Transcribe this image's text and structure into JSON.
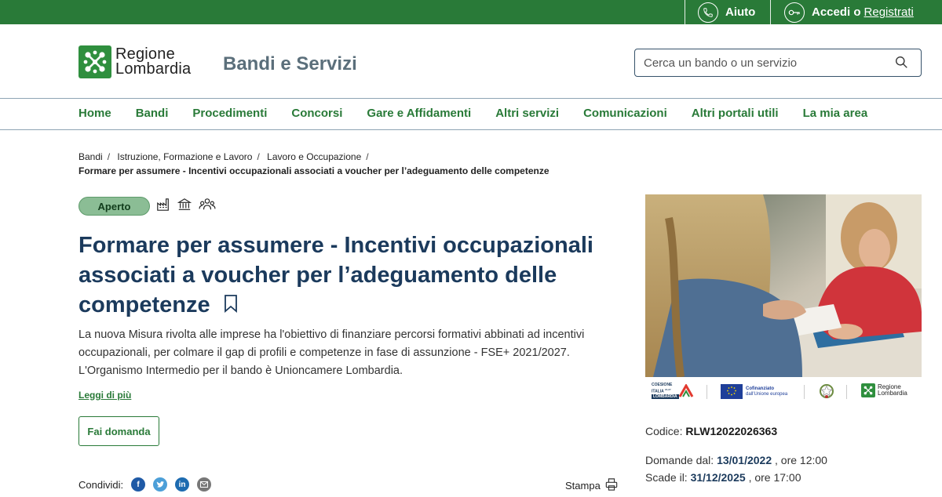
{
  "topbar": {
    "help_label": "Aiuto",
    "login_label": "Accedi o",
    "register_label": "Registrati"
  },
  "header": {
    "logo_line1": "Regione",
    "logo_line2": "Lombardia",
    "site_title": "Bandi e Servizi",
    "search_placeholder": "Cerca un bando o un servizio"
  },
  "nav": {
    "items": [
      "Home",
      "Bandi",
      "Procedimenti",
      "Concorsi",
      "Gare e Affidamenti",
      "Altri servizi",
      "Comunicazioni",
      "Altri portali utili",
      "La mia area"
    ]
  },
  "breadcrumb": {
    "items": [
      "Bandi",
      "Istruzione, Formazione e Lavoro",
      "Lavoro e Occupazione"
    ],
    "current": "Formare per assumere - Incentivi occupazionali associati a voucher per l’adeguamento delle competenze"
  },
  "status": {
    "label": "Aperto",
    "color": "#8bbd95"
  },
  "category_icons": [
    "factory-icon",
    "bank-icon",
    "people-icon"
  ],
  "main": {
    "title": "Formare per assumere - Incentivi occupazionali associati a voucher per l’adeguamento delle competenze",
    "description": "La nuova Misura rivolta alle imprese ha l'obiettivo di finanziare percorsi formativi abbinati ad incentivi occupazionali, per colmare il gap di profili e competenze in fase di assunzione - FSE+ 2021/2027. L'Organismo Intermedio per il bando è Unioncamere Lombardia.",
    "read_more": "Leggi di più",
    "apply_label": "Fai domanda",
    "share_label": "Condividi:",
    "print_label": "Stampa"
  },
  "sidebar": {
    "logos": {
      "coesione_l1": "COESIONE",
      "coesione_l2": "ITALIA",
      "coesione_sup": "21-27",
      "coesione_l3": "LOMBARDIA",
      "eu_l1": "Cofinanziato",
      "eu_l2": "dall'Unione europea",
      "rl_l1": "Regione",
      "rl_l2": "Lombardia"
    },
    "code_label": "Codice:",
    "code_value": "RLW12022026363",
    "open_label": "Domande dal:",
    "open_date": "13/01/2022",
    "open_time": ", ore 12:00",
    "close_label": "Scade il:",
    "close_date": "31/12/2025",
    "close_time": ", ore 17:00"
  },
  "colors": {
    "brand_green": "#297a38",
    "title_blue": "#1b3a5c"
  }
}
